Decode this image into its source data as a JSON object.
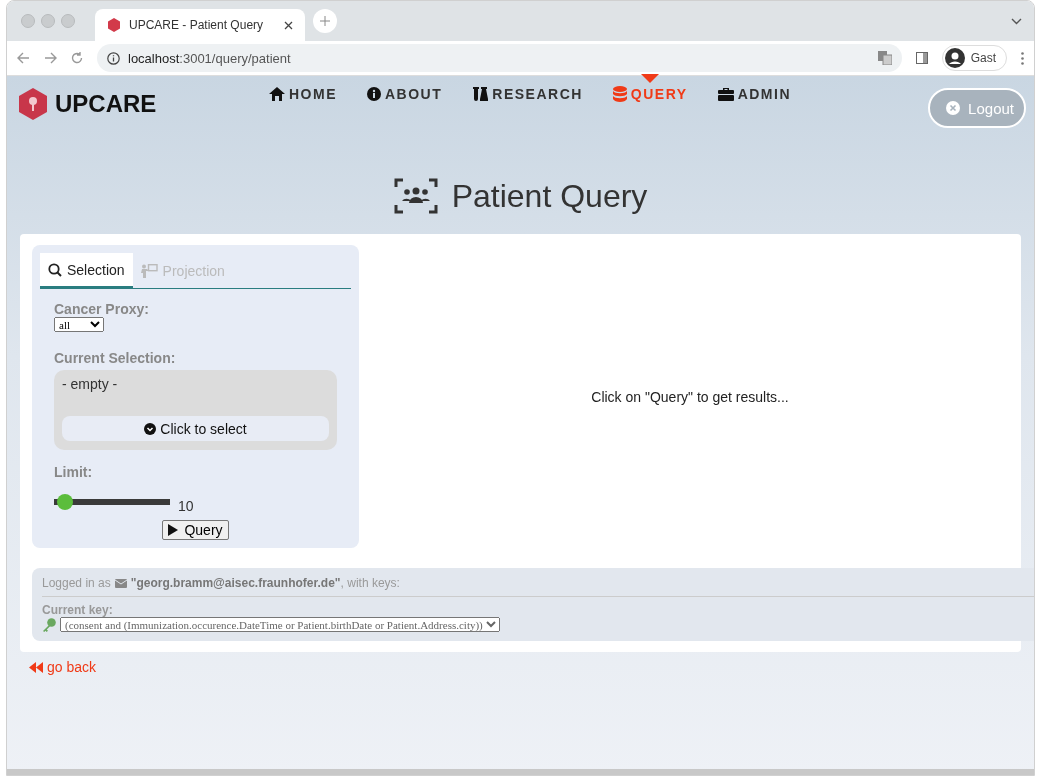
{
  "browser": {
    "tab_title": "UPCARE - Patient Query",
    "url_host": "localhost",
    "url_path": ":3001/query/patient",
    "profile": "Gast"
  },
  "brand": "UPCARE",
  "nav": [
    {
      "label": "HOME",
      "kind": "home",
      "selected": false
    },
    {
      "label": "ABOUT",
      "kind": "info",
      "selected": false
    },
    {
      "label": "RESEARCH",
      "kind": "flask",
      "selected": false
    },
    {
      "label": "QUERY",
      "kind": "database",
      "selected": true
    },
    {
      "label": "ADMIN",
      "kind": "toolbox",
      "selected": false
    }
  ],
  "logout": "Logout",
  "page_title": "Patient Query",
  "tabs": [
    {
      "label": "Selection",
      "kind": "search",
      "selected": true,
      "disabled": false
    },
    {
      "label": "Projection",
      "kind": "projection",
      "selected": false,
      "disabled": true
    }
  ],
  "cancer_proxy": {
    "label": "Cancer Proxy:",
    "value": "all"
  },
  "current_selection": {
    "label": "Current Selection:",
    "value": "- empty -",
    "button": "Click to select"
  },
  "limit": {
    "label": "Limit:",
    "level": 0.03,
    "reading": "10"
  },
  "query_button": "Query",
  "results_hint": "Click on \"Query\" to get results...",
  "account": {
    "prefix": "Logged in as",
    "text": "**\"georg.bramm@aisec.fraunhofer.de\"**, with keys:",
    "key_label": "Current key:",
    "key_value": "(consent and (Immunization.occurence.DateTime or Patient.birthDate or Patient.Address.city))"
  },
  "go_back": "go back"
}
